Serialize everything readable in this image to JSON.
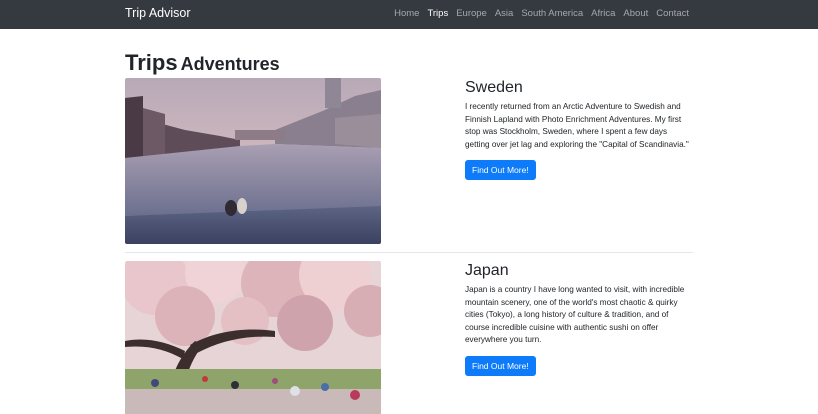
{
  "navbar": {
    "brand": "Trip Advisor",
    "items": [
      {
        "label": "Home",
        "active": false
      },
      {
        "label": "Trips",
        "active": true
      },
      {
        "label": "Europe",
        "active": false
      },
      {
        "label": "Asia",
        "active": false
      },
      {
        "label": "South America",
        "active": false
      },
      {
        "label": "Africa",
        "active": false
      },
      {
        "label": "About",
        "active": false
      },
      {
        "label": "Contact",
        "active": false
      }
    ]
  },
  "page": {
    "title": "Trips",
    "subtitle": "Adventures"
  },
  "trips": [
    {
      "title": "Sweden",
      "text": "I recently returned from an Arctic Adventure to Swedish and Finnish Lapland with Photo Enrichment Adventures. My first stop was Stockholm, Sweden, where I spent a few days getting over jet lag and exploring the \"Capital of Scandinavia.\"",
      "button": "Find Out More!"
    },
    {
      "title": "Japan",
      "text": "Japan is a country I have long wanted to visit, with incredible mountain scenery, one of the world's most chaotic & quirky cities (Tokyo), a long history of culture & tradition, and of course incredible cuisine with authentic sushi on offer everywhere you turn.",
      "button": "Find Out More!"
    }
  ],
  "colors": {
    "navbar_bg": "#343a40",
    "button_bg": "#0d7bfa"
  }
}
